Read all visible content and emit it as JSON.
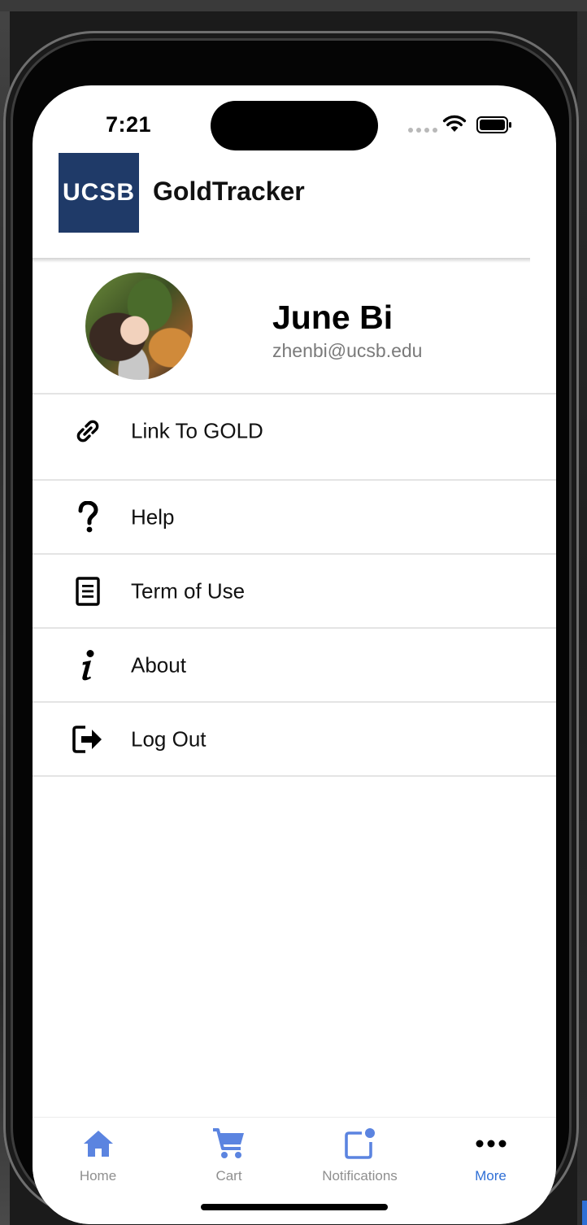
{
  "status_bar": {
    "time": "7:21"
  },
  "header": {
    "logo_text": "UCSB",
    "title": "GoldTracker"
  },
  "profile": {
    "name": "June Bi",
    "email": "zhenbi@ucsb.edu"
  },
  "menu": [
    {
      "label": "Link To GOLD",
      "icon": "link-icon"
    },
    {
      "label": "Help",
      "icon": "question-mark-icon"
    },
    {
      "label": "Term of Use",
      "icon": "document-icon"
    },
    {
      "label": "About",
      "icon": "info-icon"
    },
    {
      "label": "Log Out",
      "icon": "logout-icon"
    }
  ],
  "tabs": [
    {
      "label": "Home",
      "icon": "home-icon",
      "active": false
    },
    {
      "label": "Cart",
      "icon": "cart-icon",
      "active": false
    },
    {
      "label": "Notifications",
      "icon": "notifications-icon",
      "active": false
    },
    {
      "label": "More",
      "icon": "more-icon",
      "active": true
    }
  ],
  "colors": {
    "logo_bg": "#1f3a68",
    "tab_icon": "#5b84e0",
    "tab_active": "#2f6fd6",
    "tab_inactive": "#8f8f8f"
  }
}
